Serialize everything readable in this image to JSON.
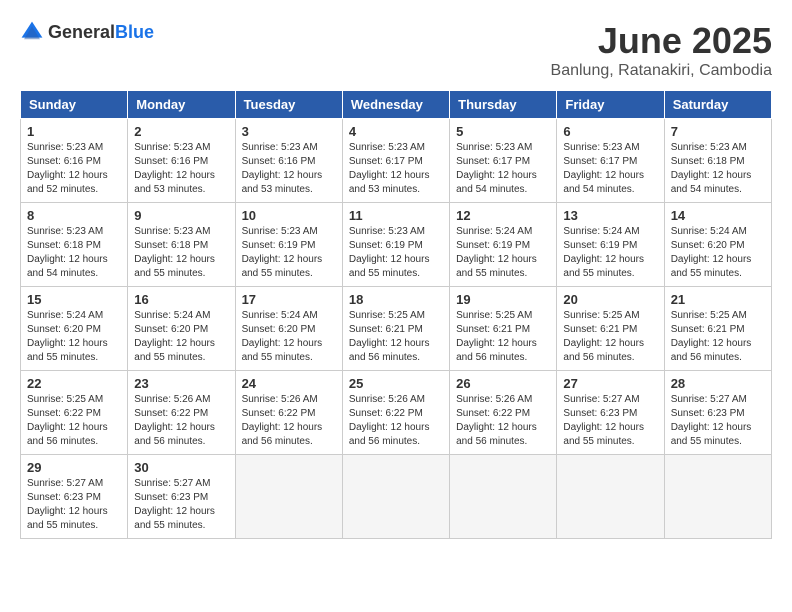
{
  "header": {
    "logo_general": "General",
    "logo_blue": "Blue",
    "month_title": "June 2025",
    "location": "Banlung, Ratanakiri, Cambodia"
  },
  "columns": [
    "Sunday",
    "Monday",
    "Tuesday",
    "Wednesday",
    "Thursday",
    "Friday",
    "Saturday"
  ],
  "weeks": [
    [
      {
        "day": "1",
        "sunrise": "Sunrise: 5:23 AM",
        "sunset": "Sunset: 6:16 PM",
        "daylight": "Daylight: 12 hours and 52 minutes."
      },
      {
        "day": "2",
        "sunrise": "Sunrise: 5:23 AM",
        "sunset": "Sunset: 6:16 PM",
        "daylight": "Daylight: 12 hours and 53 minutes."
      },
      {
        "day": "3",
        "sunrise": "Sunrise: 5:23 AM",
        "sunset": "Sunset: 6:16 PM",
        "daylight": "Daylight: 12 hours and 53 minutes."
      },
      {
        "day": "4",
        "sunrise": "Sunrise: 5:23 AM",
        "sunset": "Sunset: 6:17 PM",
        "daylight": "Daylight: 12 hours and 53 minutes."
      },
      {
        "day": "5",
        "sunrise": "Sunrise: 5:23 AM",
        "sunset": "Sunset: 6:17 PM",
        "daylight": "Daylight: 12 hours and 54 minutes."
      },
      {
        "day": "6",
        "sunrise": "Sunrise: 5:23 AM",
        "sunset": "Sunset: 6:17 PM",
        "daylight": "Daylight: 12 hours and 54 minutes."
      },
      {
        "day": "7",
        "sunrise": "Sunrise: 5:23 AM",
        "sunset": "Sunset: 6:18 PM",
        "daylight": "Daylight: 12 hours and 54 minutes."
      }
    ],
    [
      {
        "day": "8",
        "sunrise": "Sunrise: 5:23 AM",
        "sunset": "Sunset: 6:18 PM",
        "daylight": "Daylight: 12 hours and 54 minutes."
      },
      {
        "day": "9",
        "sunrise": "Sunrise: 5:23 AM",
        "sunset": "Sunset: 6:18 PM",
        "daylight": "Daylight: 12 hours and 55 minutes."
      },
      {
        "day": "10",
        "sunrise": "Sunrise: 5:23 AM",
        "sunset": "Sunset: 6:19 PM",
        "daylight": "Daylight: 12 hours and 55 minutes."
      },
      {
        "day": "11",
        "sunrise": "Sunrise: 5:23 AM",
        "sunset": "Sunset: 6:19 PM",
        "daylight": "Daylight: 12 hours and 55 minutes."
      },
      {
        "day": "12",
        "sunrise": "Sunrise: 5:24 AM",
        "sunset": "Sunset: 6:19 PM",
        "daylight": "Daylight: 12 hours and 55 minutes."
      },
      {
        "day": "13",
        "sunrise": "Sunrise: 5:24 AM",
        "sunset": "Sunset: 6:19 PM",
        "daylight": "Daylight: 12 hours and 55 minutes."
      },
      {
        "day": "14",
        "sunrise": "Sunrise: 5:24 AM",
        "sunset": "Sunset: 6:20 PM",
        "daylight": "Daylight: 12 hours and 55 minutes."
      }
    ],
    [
      {
        "day": "15",
        "sunrise": "Sunrise: 5:24 AM",
        "sunset": "Sunset: 6:20 PM",
        "daylight": "Daylight: 12 hours and 55 minutes."
      },
      {
        "day": "16",
        "sunrise": "Sunrise: 5:24 AM",
        "sunset": "Sunset: 6:20 PM",
        "daylight": "Daylight: 12 hours and 55 minutes."
      },
      {
        "day": "17",
        "sunrise": "Sunrise: 5:24 AM",
        "sunset": "Sunset: 6:20 PM",
        "daylight": "Daylight: 12 hours and 55 minutes."
      },
      {
        "day": "18",
        "sunrise": "Sunrise: 5:25 AM",
        "sunset": "Sunset: 6:21 PM",
        "daylight": "Daylight: 12 hours and 56 minutes."
      },
      {
        "day": "19",
        "sunrise": "Sunrise: 5:25 AM",
        "sunset": "Sunset: 6:21 PM",
        "daylight": "Daylight: 12 hours and 56 minutes."
      },
      {
        "day": "20",
        "sunrise": "Sunrise: 5:25 AM",
        "sunset": "Sunset: 6:21 PM",
        "daylight": "Daylight: 12 hours and 56 minutes."
      },
      {
        "day": "21",
        "sunrise": "Sunrise: 5:25 AM",
        "sunset": "Sunset: 6:21 PM",
        "daylight": "Daylight: 12 hours and 56 minutes."
      }
    ],
    [
      {
        "day": "22",
        "sunrise": "Sunrise: 5:25 AM",
        "sunset": "Sunset: 6:22 PM",
        "daylight": "Daylight: 12 hours and 56 minutes."
      },
      {
        "day": "23",
        "sunrise": "Sunrise: 5:26 AM",
        "sunset": "Sunset: 6:22 PM",
        "daylight": "Daylight: 12 hours and 56 minutes."
      },
      {
        "day": "24",
        "sunrise": "Sunrise: 5:26 AM",
        "sunset": "Sunset: 6:22 PM",
        "daylight": "Daylight: 12 hours and 56 minutes."
      },
      {
        "day": "25",
        "sunrise": "Sunrise: 5:26 AM",
        "sunset": "Sunset: 6:22 PM",
        "daylight": "Daylight: 12 hours and 56 minutes."
      },
      {
        "day": "26",
        "sunrise": "Sunrise: 5:26 AM",
        "sunset": "Sunset: 6:22 PM",
        "daylight": "Daylight: 12 hours and 56 minutes."
      },
      {
        "day": "27",
        "sunrise": "Sunrise: 5:27 AM",
        "sunset": "Sunset: 6:23 PM",
        "daylight": "Daylight: 12 hours and 55 minutes."
      },
      {
        "day": "28",
        "sunrise": "Sunrise: 5:27 AM",
        "sunset": "Sunset: 6:23 PM",
        "daylight": "Daylight: 12 hours and 55 minutes."
      }
    ],
    [
      {
        "day": "29",
        "sunrise": "Sunrise: 5:27 AM",
        "sunset": "Sunset: 6:23 PM",
        "daylight": "Daylight: 12 hours and 55 minutes."
      },
      {
        "day": "30",
        "sunrise": "Sunrise: 5:27 AM",
        "sunset": "Sunset: 6:23 PM",
        "daylight": "Daylight: 12 hours and 55 minutes."
      },
      null,
      null,
      null,
      null,
      null
    ]
  ]
}
